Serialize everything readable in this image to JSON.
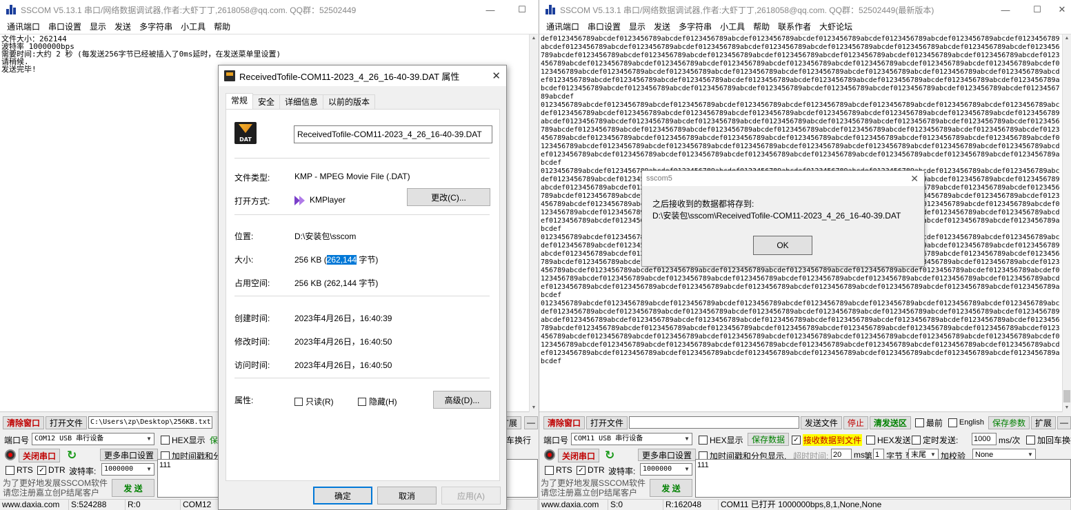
{
  "left": {
    "title": "SSCOM V5.13.1 串口/网络数据调试器,作者:大虾丁丁,2618058@qq.com. QQ群：52502449",
    "menu": [
      "通讯端口",
      "串口设置",
      "显示",
      "发送",
      "多字符串",
      "小工具",
      "帮助"
    ],
    "log": "文件大小：262144\n波特率 1000000bps\n需要时间:大约 2 秒 (每发送256字节已经被插入了0ms延时，在发送菜单里设置)\n请稍候.\n发送完毕!",
    "clear_btn": "清除窗口",
    "open_file_btn": "打开文件",
    "file_path": "C:\\Users\\zp\\Desktop\\256KB.txt",
    "expand_btn": "扩展",
    "port_label": "端口号",
    "port_value": "COM12 USB 串行设备",
    "hex_display": "HEX显示",
    "add_timestamp": "加时间戳和分",
    "line_break": "车换行",
    "close_port_btn": "关闭串口",
    "more_settings": "更多串口设置",
    "rts": "RTS",
    "dtr": "DTR",
    "baud_label": "波特率:",
    "baud_value": "1000000",
    "send_text": "111",
    "send_btn": "发 送",
    "promo1": "为了更好地发展SSCOM软件",
    "promo2": "请您注册嘉立创P结尾客户",
    "status": [
      "www.daxia.com",
      "S:524288",
      "R:0",
      "COM12"
    ]
  },
  "right": {
    "title": "SSCOM V5.13.1 串口/网络数据调试器,作者:大虾丁丁,2618058@qq.com. QQ群：52502449(最新版本)",
    "menu": [
      "通讯端口",
      "串口设置",
      "显示",
      "发送",
      "多字符串",
      "小工具",
      "帮助",
      "联系作者",
      "大虾论坛"
    ],
    "clear_btn": "清除窗口",
    "open_file_btn": "打开文件",
    "send_file_btn": "发送文件",
    "stop_btn": "停止",
    "clear_send_btn": "清发送区",
    "front": "最前",
    "english": "English",
    "save_params": "保存参数",
    "expand_btn": "扩展",
    "port_label": "端口号",
    "port_value": "COM11 USB 串行设备",
    "hex_display": "HEX显示",
    "save_data": "保存数据",
    "recv_to_file": "接收数据到文件",
    "hex_send": "HEX发送",
    "timed_send": "定时发送:",
    "interval": "1000",
    "interval_unit": "ms/次",
    "add_crlf": "加回车换行",
    "close_port_btn": "关闭串口",
    "more_settings": "更多串口设置",
    "add_ts": "加时间戳和分包显示,",
    "timeout_label": "超时时间:",
    "timeout_value": "20",
    "ms": "ms",
    "nth": "第",
    "byte_idx": "1",
    "byte_to": "字节 至",
    "tail": "末尾",
    "checksum_label": "加校验",
    "checksum_value": "None",
    "rts": "RTS",
    "dtr": "DTR",
    "baud_label": "波特率:",
    "baud_value": "1000000",
    "send_text": "111",
    "send_btn": "发 送",
    "promo1": "为了更好地发展SSCOM软件",
    "promo2": "请您注册嘉立创P结尾客户",
    "status": [
      "www.daxia.com",
      "S:0",
      "R:162048",
      "COM11 已打开  1000000bps,8,1,None,None"
    ]
  },
  "props": {
    "title": "ReceivedTofile-COM11-2023_4_26_16-40-39.DAT 属性",
    "tabs": [
      "常规",
      "安全",
      "详细信息",
      "以前的版本"
    ],
    "icon_text": "DAT",
    "filename": "ReceivedTofile-COM11-2023_4_26_16-40-39.DAT",
    "type_label": "文件类型:",
    "type_value": "KMP - MPEG Movie File (.DAT)",
    "open_label": "打开方式:",
    "open_value": "KMPlayer",
    "change_btn": "更改(C)...",
    "loc_label": "位置:",
    "loc_value": "D:\\安装包\\sscom",
    "size_label": "大小:",
    "size_pre": "256 KB (",
    "size_hl": "262,144",
    "size_post": " 字节)",
    "disk_label": "占用空间:",
    "disk_value": "256 KB (262,144 字节)",
    "created_label": "创建时间:",
    "created_value": "2023年4月26日，16:40:39",
    "modified_label": "修改时间:",
    "modified_value": "2023年4月26日，16:40:50",
    "accessed_label": "访问时间:",
    "accessed_value": "2023年4月26日，16:40:50",
    "attr_label": "属性:",
    "readonly": "只读(R)",
    "hidden": "隐藏(H)",
    "advanced_btn": "高级(D)...",
    "ok_btn": "确定",
    "cancel_btn": "取消",
    "apply_btn": "应用(A)"
  },
  "msg": {
    "title": "sscom5",
    "line1": "之后接收到的数据都将存到:",
    "line2": "D:\\安装包\\sscom\\ReceivedTofile-COM11-2023_4_26_16-40-39.DAT",
    "ok": "OK"
  },
  "colors": {
    "accent": "#0078d7",
    "red": "#c00000",
    "green": "#008000",
    "highlight": "#ffff00"
  }
}
